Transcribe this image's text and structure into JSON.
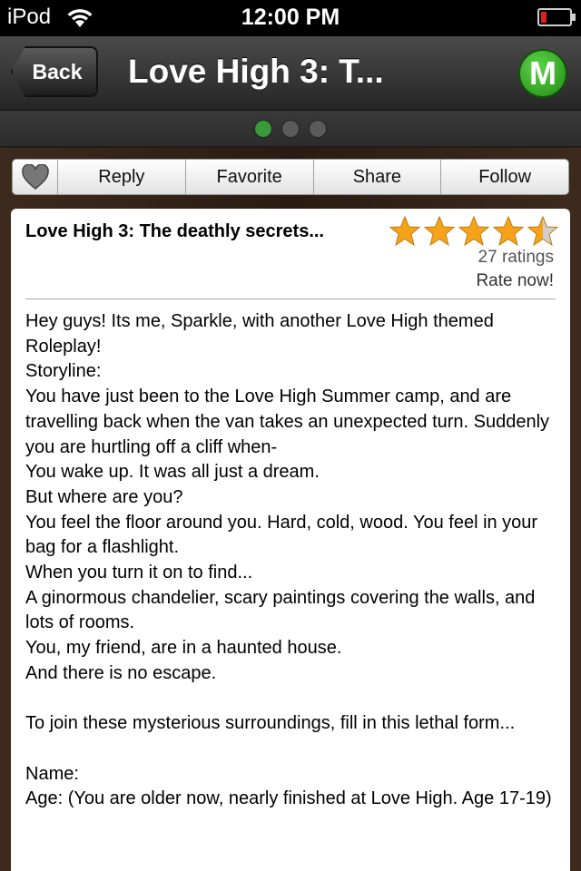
{
  "status_bar": {
    "device": "iPod",
    "time": "12:00 PM"
  },
  "nav": {
    "back_label": "Back",
    "title": "Love High 3: T...",
    "logo_letter": "M"
  },
  "page_indicator": {
    "count": 3,
    "active": 1
  },
  "actions": {
    "reply": "Reply",
    "favorite": "Favorite",
    "share": "Share",
    "follow": "Follow"
  },
  "post": {
    "title": "Love High 3: The deathly secrets...",
    "rating": 4.5,
    "rating_count": "27 ratings",
    "rate_now": "Rate now!",
    "lines": [
      "Hey guys! Its me, Sparkle, with another Love High themed Roleplay!",
      "Storyline:",
      "You have just been to the Love High Summer camp, and are travelling back when the van takes an unexpected turn. Suddenly you are hurtling off a cliff when-",
      "You wake up. It was all just a dream.",
      "But where are you?",
      "You feel the floor around you. Hard, cold, wood. You feel in your bag for a flashlight.",
      "When you turn it on to find...",
      "A ginormous chandelier, scary paintings covering the walls, and lots of rooms.",
      "You, my friend, are in a haunted house.",
      "And there is no escape.",
      "",
      "To join these mysterious surroundings, fill in this lethal form...",
      "",
      "Name:",
      "Age: (You are older now, nearly finished at Love High. Age 17-19)"
    ]
  },
  "colors": {
    "star_fill": "#f5a31a",
    "star_empty": "#cfcfcf",
    "logo_green": "#2fa61f",
    "page_dot_active": "#3a9a3a"
  }
}
